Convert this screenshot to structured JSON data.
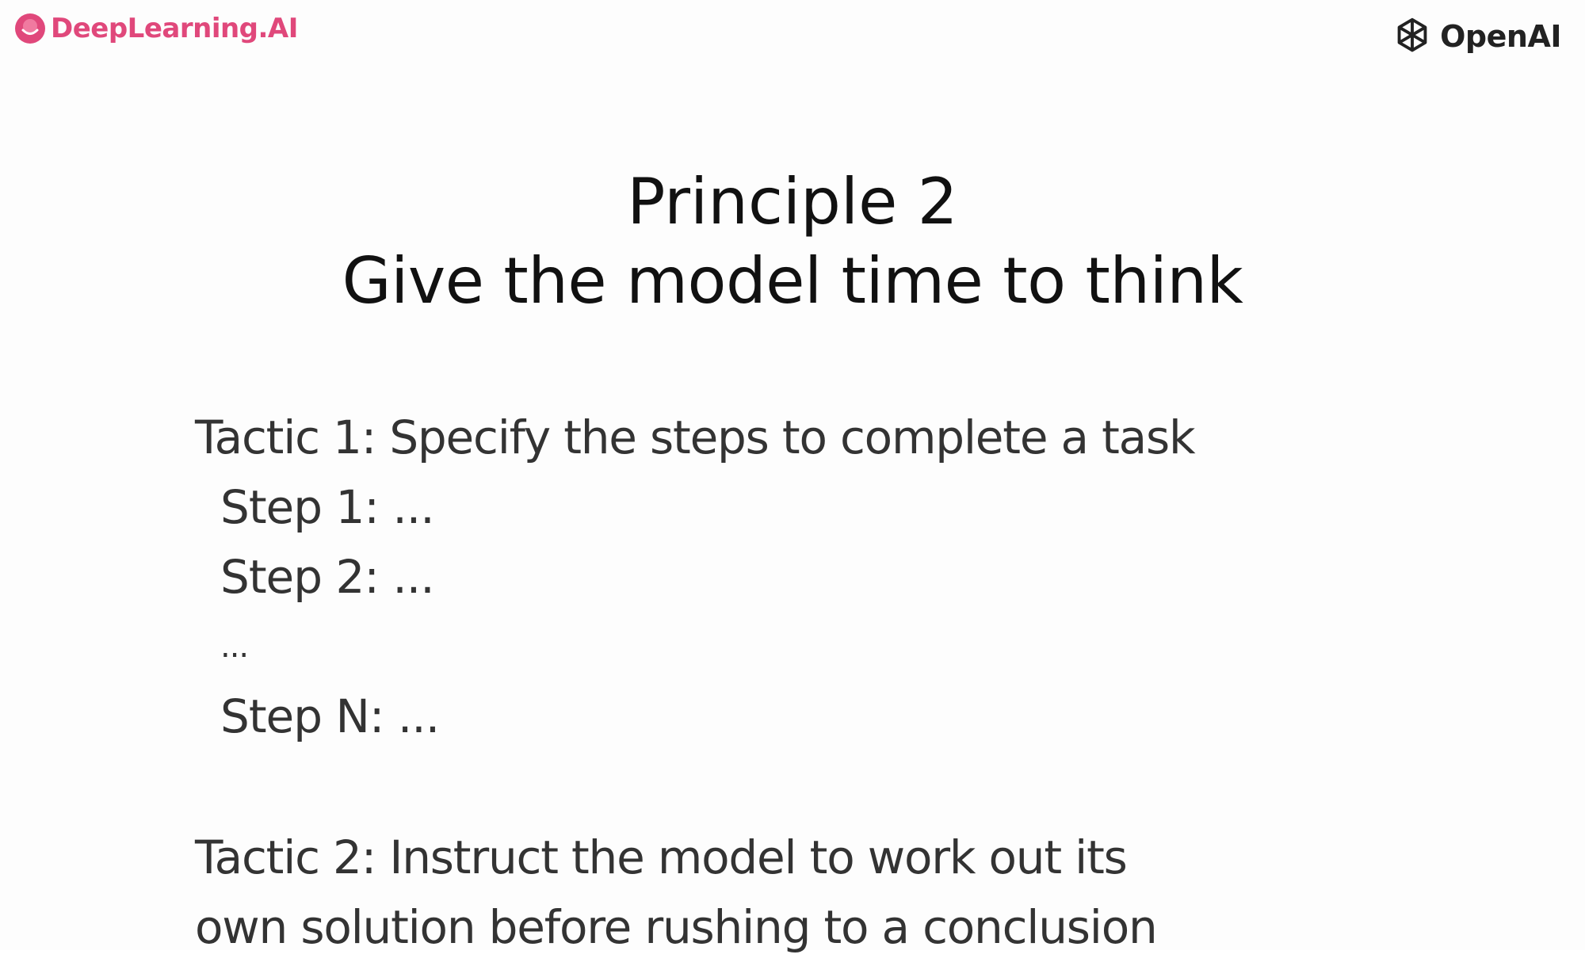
{
  "header": {
    "left_logo": {
      "icon": "deeplearning-logo-icon",
      "text": "DeepLearning.AI",
      "color": "#e0487b"
    },
    "right_logo": {
      "icon": "openai-logo-icon",
      "text": "OpenAI",
      "color": "#222222"
    }
  },
  "title": {
    "line1": "Principle 2",
    "line2": "Give the model time to think"
  },
  "tactic1": {
    "heading": "Tactic 1: Specify the steps to complete a task",
    "steps": [
      "Step 1: ...",
      "Step 2: ...",
      "...",
      "Step N: ..."
    ]
  },
  "tactic2": {
    "line1": "Tactic 2: Instruct the model to work out its",
    "line2": "own solution before rushing to a conclusion"
  }
}
